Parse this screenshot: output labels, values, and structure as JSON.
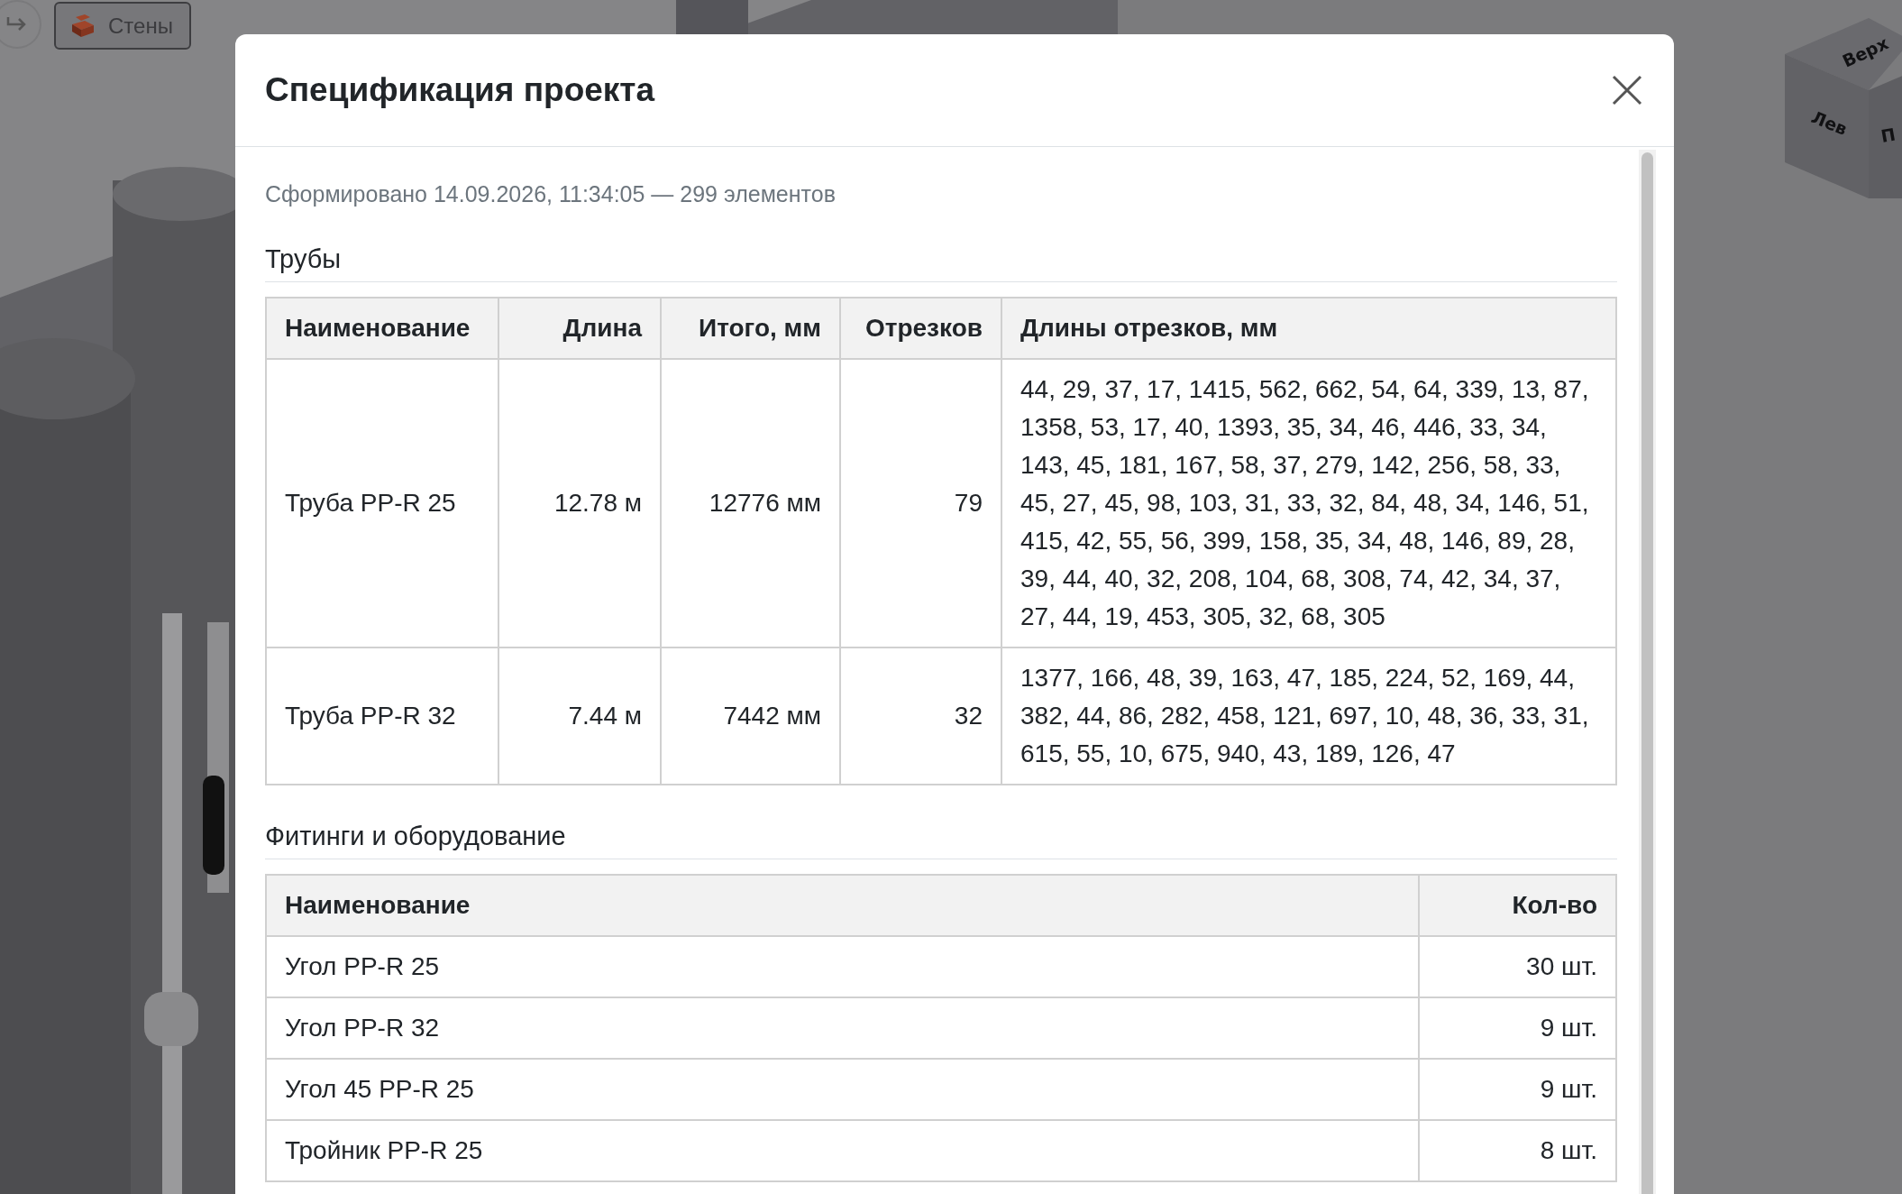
{
  "toolbar": {
    "walls_button": {
      "label": "Стены"
    }
  },
  "view_cube": {
    "faces": [
      "Верх",
      "Лев",
      "П"
    ]
  },
  "dialog": {
    "title": "Спецификация проекта",
    "generated": "Сформировано 14.09.2026, 11:34:05 — 299 элементов",
    "sections": [
      {
        "kind": "pipes",
        "title": "Трубы",
        "columns": [
          "Наименование",
          "Длина",
          "Итого, мм",
          "Отрезков",
          "Длины отрезков, мм"
        ],
        "rows": [
          [
            "Труба PP-R 25",
            "12.78 м",
            "12776 мм",
            "79",
            "44, 29, 37, 17, 1415, 562, 662, 54, 64, 339, 13, 87, 1358, 53, 17, 40, 1393, 35, 34, 46, 446, 33, 34, 143, 45, 181, 167, 58, 37, 279, 142, 256, 58, 33, 45, 27, 45, 98, 103, 31, 33, 32, 84, 48, 34, 146, 51, 415, 42, 55, 56, 399, 158, 35, 34, 48, 146, 89, 28, 39, 44, 40, 32, 208, 104, 68, 308, 74, 42, 34, 37, 27, 44, 19, 453, 305, 32, 68, 305"
          ],
          [
            "Труба PP-R 32",
            "7.44 м",
            "7442 мм",
            "32",
            "1377, 166, 48, 39, 163, 47, 185, 224, 52, 169, 44, 382, 44, 86, 282, 458, 121, 697, 10, 48, 36, 33, 31, 615, 55, 10, 675, 940, 43, 189, 126, 47"
          ]
        ]
      },
      {
        "kind": "fittings",
        "title": "Фитинги и оборудование",
        "columns": [
          "Наименование",
          "Кол-во"
        ],
        "rows": [
          [
            "Угол PP-R 25",
            "30 шт."
          ],
          [
            "Угол PP-R 32",
            "9 шт."
          ],
          [
            "Угол 45 PP-R 25",
            "9 шт."
          ],
          [
            "Тройник PP-R 25",
            "8 шт."
          ]
        ]
      }
    ]
  }
}
